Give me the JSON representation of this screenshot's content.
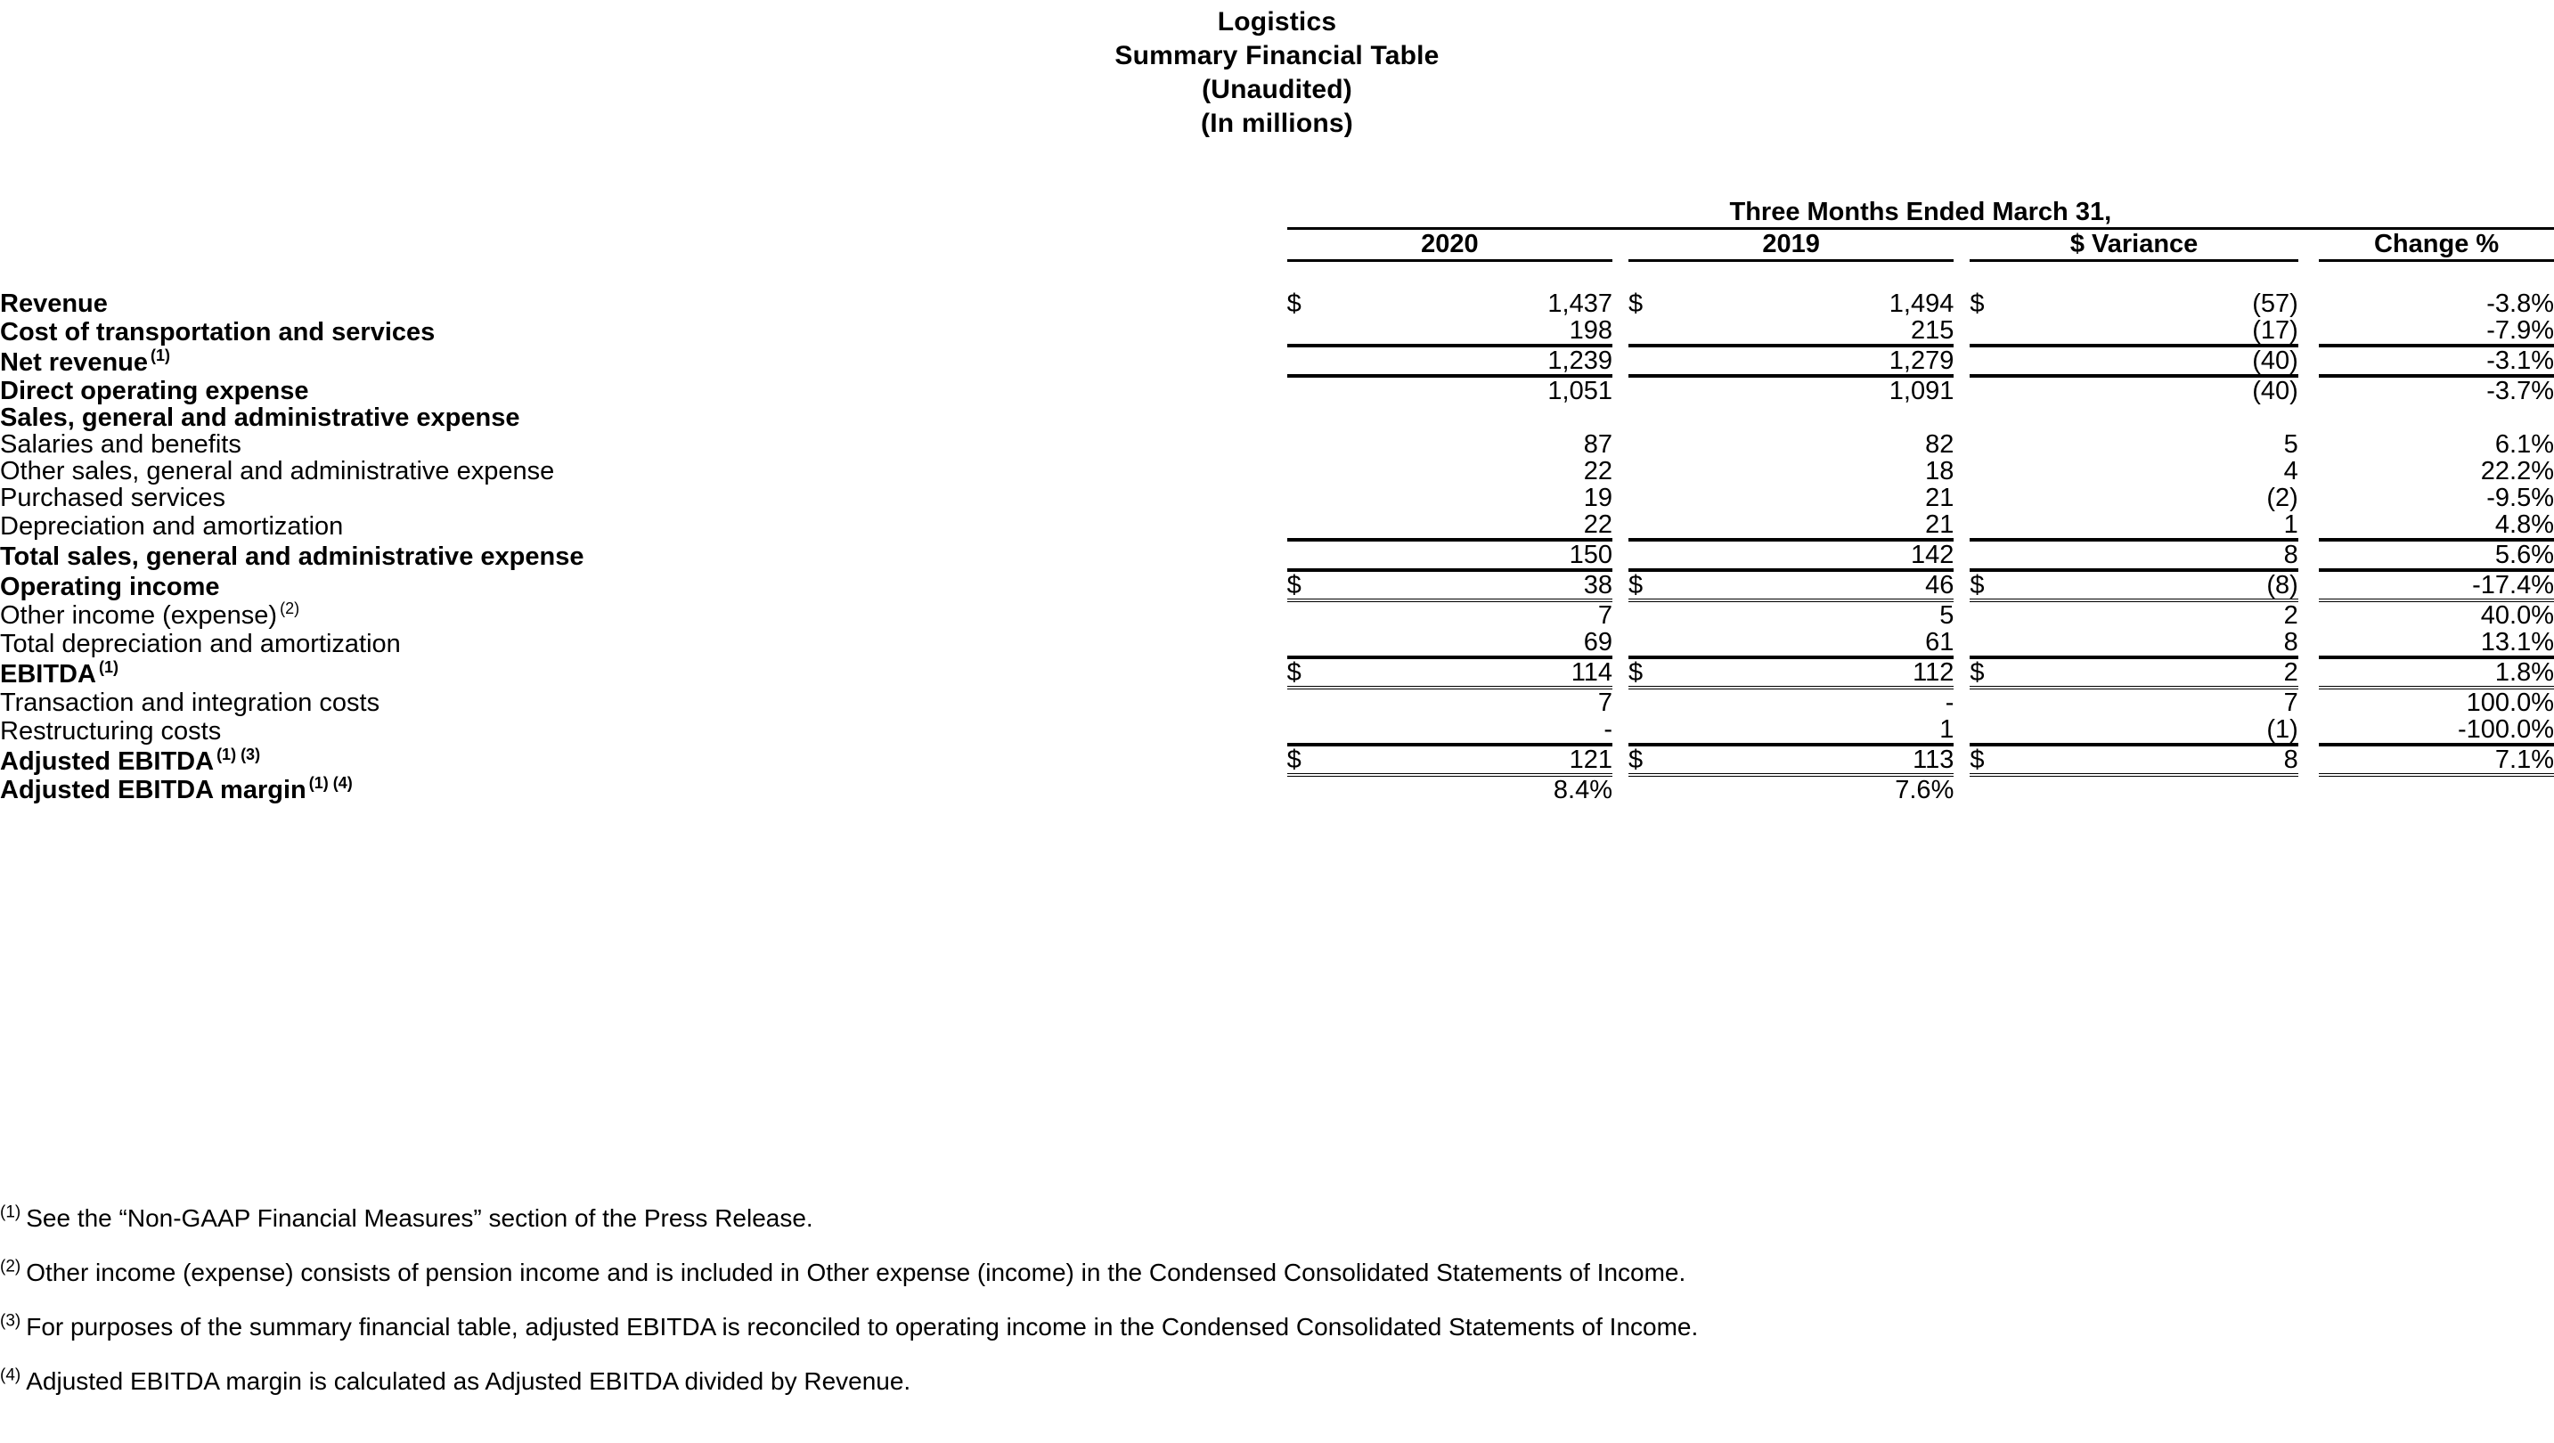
{
  "title": {
    "lines": [
      "Logistics",
      "Summary Financial Table",
      "(Unaudited)",
      "(In millions)"
    ]
  },
  "table": {
    "span_header": "Three Months Ended March 31,",
    "columns": [
      "2020",
      "2019",
      "$ Variance",
      "Change %"
    ],
    "currency_symbol": "$",
    "rows": [
      {
        "label": "Revenue",
        "bold": true,
        "indent": 0,
        "note": "",
        "sym": [
          "$",
          "$",
          "$",
          ""
        ],
        "values": [
          "1,437",
          "1,494",
          "(57)",
          "-3.8%"
        ],
        "rule": "none"
      },
      {
        "label": "Cost of transportation and services",
        "bold": true,
        "indent": 0,
        "note": "",
        "sym": [
          "",
          "",
          "",
          ""
        ],
        "values": [
          "198",
          "215",
          "(17)",
          "-7.9%"
        ],
        "rule": "single-below"
      },
      {
        "label": "Net revenue",
        "bold": true,
        "indent": 1,
        "note": "(1)",
        "sym": [
          "",
          "",
          "",
          ""
        ],
        "values": [
          "1,239",
          "1,279",
          "(40)",
          "-3.1%"
        ],
        "rule": "single-below"
      },
      {
        "label": "Direct operating expense",
        "bold": true,
        "indent": 0,
        "note": "",
        "sym": [
          "",
          "",
          "",
          ""
        ],
        "values": [
          "1,051",
          "1,091",
          "(40)",
          "-3.7%"
        ],
        "rule": "none"
      },
      {
        "label": "Sales, general and administrative expense",
        "bold": true,
        "indent": 0,
        "note": "",
        "sym": [
          "",
          "",
          "",
          ""
        ],
        "values": [
          "",
          "",
          "",
          ""
        ],
        "rule": "none"
      },
      {
        "label": "Salaries and benefits",
        "bold": false,
        "indent": 1,
        "note": "",
        "sym": [
          "",
          "",
          "",
          ""
        ],
        "values": [
          "87",
          "82",
          "5",
          "6.1%"
        ],
        "rule": "none"
      },
      {
        "label": "Other sales, general and administrative expense",
        "bold": false,
        "indent": 1,
        "note": "",
        "sym": [
          "",
          "",
          "",
          ""
        ],
        "values": [
          "22",
          "18",
          "4",
          "22.2%"
        ],
        "rule": "none"
      },
      {
        "label": "Purchased services",
        "bold": false,
        "indent": 1,
        "note": "",
        "sym": [
          "",
          "",
          "",
          ""
        ],
        "values": [
          "19",
          "21",
          "(2)",
          "-9.5%"
        ],
        "rule": "none"
      },
      {
        "label": "Depreciation and amortization",
        "bold": false,
        "indent": 1,
        "note": "",
        "sym": [
          "",
          "",
          "",
          ""
        ],
        "values": [
          "22",
          "21",
          "1",
          "4.8%"
        ],
        "rule": "single-below"
      },
      {
        "label": "Total sales, general and administrative expense",
        "bold": true,
        "indent": 0,
        "note": "",
        "sym": [
          "",
          "",
          "",
          ""
        ],
        "values": [
          "150",
          "142",
          "8",
          "5.6%"
        ],
        "rule": "single-below"
      },
      {
        "label": "Operating income",
        "bold": true,
        "indent": 0,
        "note": "",
        "sym": [
          "$",
          "$",
          "$",
          ""
        ],
        "values": [
          "38",
          "46",
          "(8)",
          "-17.4%"
        ],
        "rule": "double-below"
      },
      {
        "label": "Other income (expense)",
        "bold": false,
        "indent": 1,
        "note": "(2)",
        "sym": [
          "",
          "",
          "",
          ""
        ],
        "values": [
          "7",
          "5",
          "2",
          "40.0%"
        ],
        "rule": "none"
      },
      {
        "label": "Total depreciation and amortization",
        "bold": false,
        "indent": 1,
        "note": "",
        "sym": [
          "",
          "",
          "",
          ""
        ],
        "values": [
          "69",
          "61",
          "8",
          "13.1%"
        ],
        "rule": "single-below"
      },
      {
        "label": "EBITDA",
        "bold": true,
        "indent": 0,
        "note": "(1)",
        "sym": [
          "$",
          "$",
          "$",
          ""
        ],
        "values": [
          "114",
          "112",
          "2",
          "1.8%"
        ],
        "rule": "double-below"
      },
      {
        "label": "Transaction and integration costs",
        "bold": false,
        "indent": 1,
        "note": "",
        "sym": [
          "",
          "",
          "",
          ""
        ],
        "values": [
          "7",
          "-",
          "7",
          "100.0%"
        ],
        "rule": "none"
      },
      {
        "label": "Restructuring costs",
        "bold": false,
        "indent": 1,
        "note": "",
        "sym": [
          "",
          "",
          "",
          ""
        ],
        "values": [
          "-",
          "1",
          "(1)",
          "-100.0%"
        ],
        "rule": "single-below"
      },
      {
        "label": "Adjusted EBITDA",
        "bold": true,
        "indent": 0,
        "note": "(1) (3)",
        "sym": [
          "$",
          "$",
          "$",
          ""
        ],
        "values": [
          "121",
          "113",
          "8",
          "7.1%"
        ],
        "rule": "double-below"
      },
      {
        "label": "Adjusted EBITDA margin",
        "bold": true,
        "indent": 0,
        "note": "(1) (4)",
        "sym": [
          "",
          "",
          "",
          ""
        ],
        "values": [
          "8.4%",
          "7.6%",
          "",
          ""
        ],
        "rule": "none"
      }
    ]
  },
  "footnotes": [
    {
      "marker": "(1)",
      "text": "See the “Non-GAAP Financial Measures” section of the Press Release."
    },
    {
      "marker": "(2)",
      "text": "Other income (expense) consists of pension income and is included in Other expense (income) in the Condensed Consolidated Statements of Income."
    },
    {
      "marker": "(3)",
      "text": "For purposes of the summary financial table, adjusted EBITDA is reconciled to operating income in the Condensed Consolidated Statements of Income."
    },
    {
      "marker": "(4)",
      "text": "Adjusted EBITDA margin is calculated as Adjusted EBITDA divided by Revenue."
    }
  ]
}
